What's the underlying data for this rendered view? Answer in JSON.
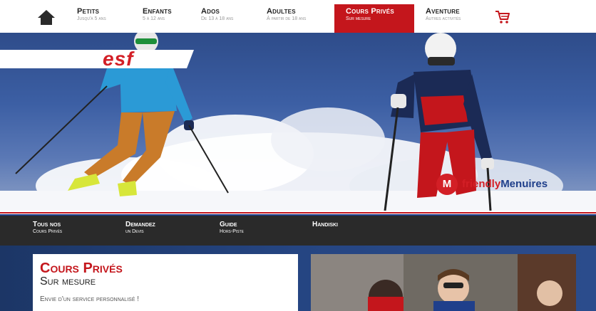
{
  "topnav": {
    "home_icon": "home-icon",
    "items": [
      {
        "title": "Petits",
        "sub": "Jusqu'à 5 ans"
      },
      {
        "title": "Enfants",
        "sub": "5 à 12 ans"
      },
      {
        "title": "Ados",
        "sub": "De 13 à 18 ans"
      },
      {
        "title": "Adultes",
        "sub": "À partir de 18 ans"
      },
      {
        "title": "Cours Privés",
        "sub": "Sur mesure"
      },
      {
        "title": "Aventure",
        "sub": "Autres activités"
      }
    ],
    "active_index": 4,
    "cart_icon": "cart-icon"
  },
  "hero": {
    "logo": "esf",
    "partner_badge": "M",
    "partner_text_1": "friendly",
    "partner_text_2": "Menuires"
  },
  "subnav": {
    "items": [
      {
        "title": "Tous nos",
        "sub": "Cours Privés"
      },
      {
        "title": "Demandez",
        "sub": "un Devis"
      },
      {
        "title": "Guide",
        "sub": "Hors-Piste"
      },
      {
        "title": "Handiski",
        "sub": ""
      }
    ]
  },
  "content": {
    "title": "Cours Privés",
    "subtitle": "Sur mesure",
    "text": "Envie d'un service personnalisé !"
  },
  "colors": {
    "accent": "#c4161c",
    "navy": "#1f3f8b",
    "subnav_bg": "#2a2a2a"
  }
}
